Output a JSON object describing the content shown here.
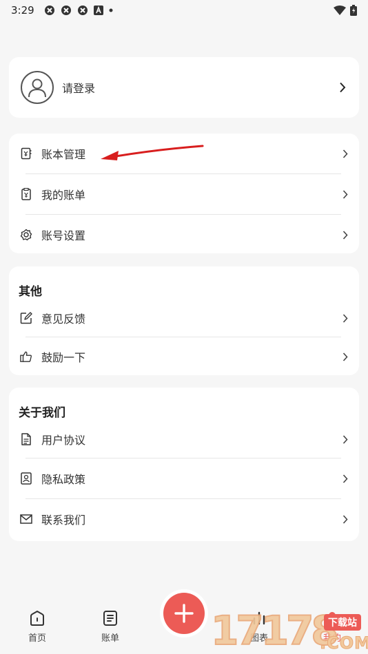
{
  "status_bar": {
    "time": "3:29"
  },
  "login": {
    "label": "请登录"
  },
  "group1": {
    "items": [
      {
        "label": "账本管理",
        "icon": "ledger-icon"
      },
      {
        "label": "我的账单",
        "icon": "bill-icon"
      },
      {
        "label": "账号设置",
        "icon": "gear-icon"
      }
    ]
  },
  "group2": {
    "title": "其他",
    "items": [
      {
        "label": "意见反馈",
        "icon": "edit-icon"
      },
      {
        "label": "鼓励一下",
        "icon": "thumbs-up-icon"
      }
    ]
  },
  "group3": {
    "title": "关于我们",
    "items": [
      {
        "label": "用户协议",
        "icon": "document-icon"
      },
      {
        "label": "隐私政策",
        "icon": "privacy-icon"
      },
      {
        "label": "联系我们",
        "icon": "mail-icon"
      }
    ]
  },
  "bottom_nav": {
    "home": "首页",
    "bills": "账单",
    "charts": "图表",
    "mine": "我的"
  },
  "watermark": {
    "digits": "17178",
    "badge": "下载站",
    "com": ".COM"
  },
  "colors": {
    "accent": "#ec5b56",
    "background": "#f6f6f6",
    "card": "#ffffff",
    "annotation": "#d81e1e"
  }
}
